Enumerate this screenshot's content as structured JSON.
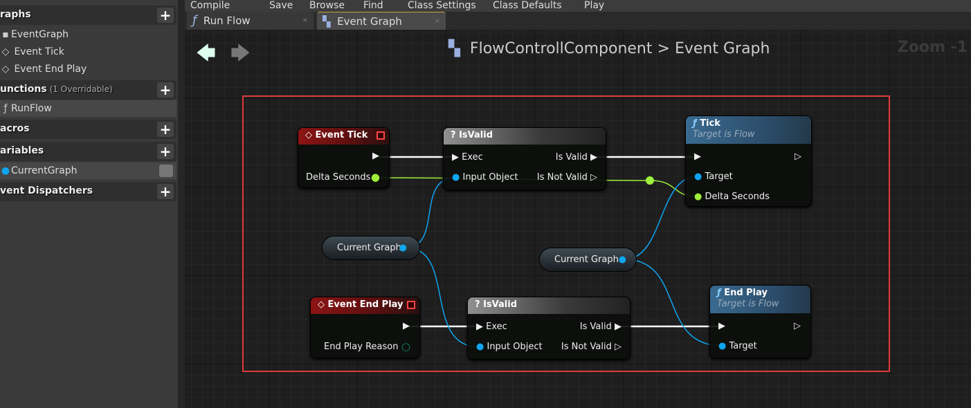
{
  "sidebar": {
    "graphs": {
      "title": "raphs",
      "items": [
        "EventGraph",
        "Event Tick",
        "Event End Play"
      ]
    },
    "functions": {
      "title": "unctions",
      "note": "(1 Overridable)",
      "items": [
        "RunFlow"
      ]
    },
    "macros": {
      "title": "acros"
    },
    "variables": {
      "title": "ariables",
      "items": [
        "CurrentGraph"
      ]
    },
    "dispatchers": {
      "title": "vent Dispatchers"
    },
    "add_label": "+"
  },
  "toolbar": [
    "Compile",
    "Save",
    "Browse",
    "Find",
    "Class Settings",
    "Class Defaults",
    "Play"
  ],
  "tabs": [
    {
      "label": "Run Flow",
      "icon": "function-icon"
    },
    {
      "label": "Event Graph",
      "icon": "graph-icon",
      "active": true
    }
  ],
  "tab_close": "×",
  "breadcrumb": {
    "blueprint": "FlowControllComponent",
    "sep": ">",
    "graph": "Event Graph"
  },
  "zoom": "Zoom -1",
  "nodes": {
    "event_tick": {
      "title": "Event Tick",
      "pins": [
        "Delta Seconds"
      ]
    },
    "isvalid1": {
      "title": "IsValid",
      "in": [
        "Exec",
        "Input Object"
      ],
      "out": [
        "Is Valid",
        "Is Not Valid"
      ]
    },
    "tick": {
      "title": "Tick",
      "subtitle": "Target is Flow",
      "pins": [
        "Target",
        "Delta Seconds"
      ]
    },
    "current_graph1": {
      "title": "Current Graph"
    },
    "current_graph2": {
      "title": "Current Graph"
    },
    "event_end_play": {
      "title": "Event End Play",
      "pins": [
        "End Play Reason"
      ]
    },
    "isvalid2": {
      "title": "IsValid",
      "in": [
        "Exec",
        "Input Object"
      ],
      "out": [
        "Is Valid",
        "Is Not Valid"
      ]
    },
    "end_play": {
      "title": "End Play",
      "subtitle": "Target is Flow",
      "pins": [
        "Target"
      ]
    }
  },
  "colors": {
    "exec": "#ffffff",
    "float": "#9ef03a",
    "object": "#0ea5f0",
    "enum": "#0a6a5a",
    "highlight": "#e03a3a"
  }
}
